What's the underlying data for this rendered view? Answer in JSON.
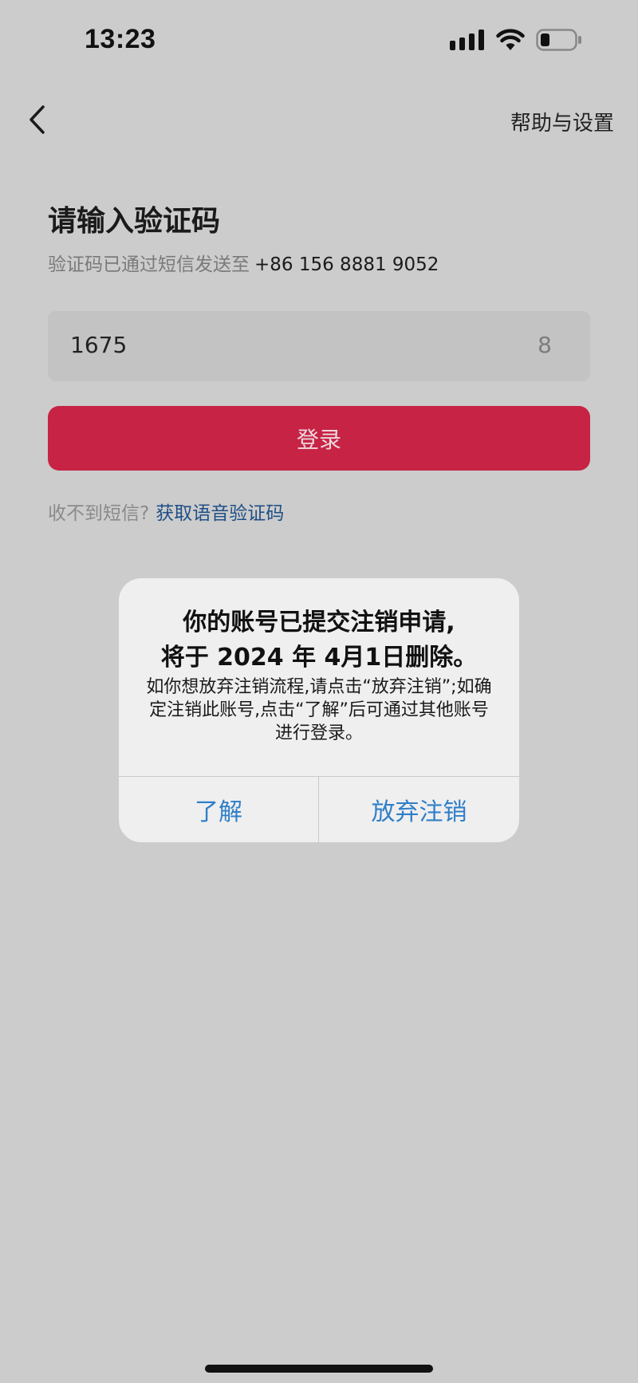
{
  "status_bar": {
    "time": "13:23",
    "icons": [
      "cellular-signal-icon",
      "wifi-icon",
      "battery-icon"
    ]
  },
  "nav": {
    "back_icon": "chevron-left-icon",
    "help_label": "帮助与设置"
  },
  "login": {
    "title": "请输入验证码",
    "sent_prefix": "验证码已通过短信发送至",
    "phone": "+86 156 8881 9052",
    "code_value": "1675",
    "code_counter": "8",
    "login_button": "登录",
    "no_sms_text": "收不到短信?",
    "voice_code_link": "获取语音验证码"
  },
  "dialog": {
    "title_line1": "你的账号已提交注销申请,",
    "title_line2": "将于 2024 年 4月1日删除。",
    "message": "如你想放弃注销流程,请点击“放弃注销”;如确定注销此账号,点击“了解”后可通过其他账号进行登录。",
    "button_understand": "了解",
    "button_abandon": "放弃注销"
  },
  "colors": {
    "background": "#cccccc",
    "accent_button": "#c72345",
    "link": "#1f4f86",
    "dialog_button_text": "#2f7fc9"
  }
}
